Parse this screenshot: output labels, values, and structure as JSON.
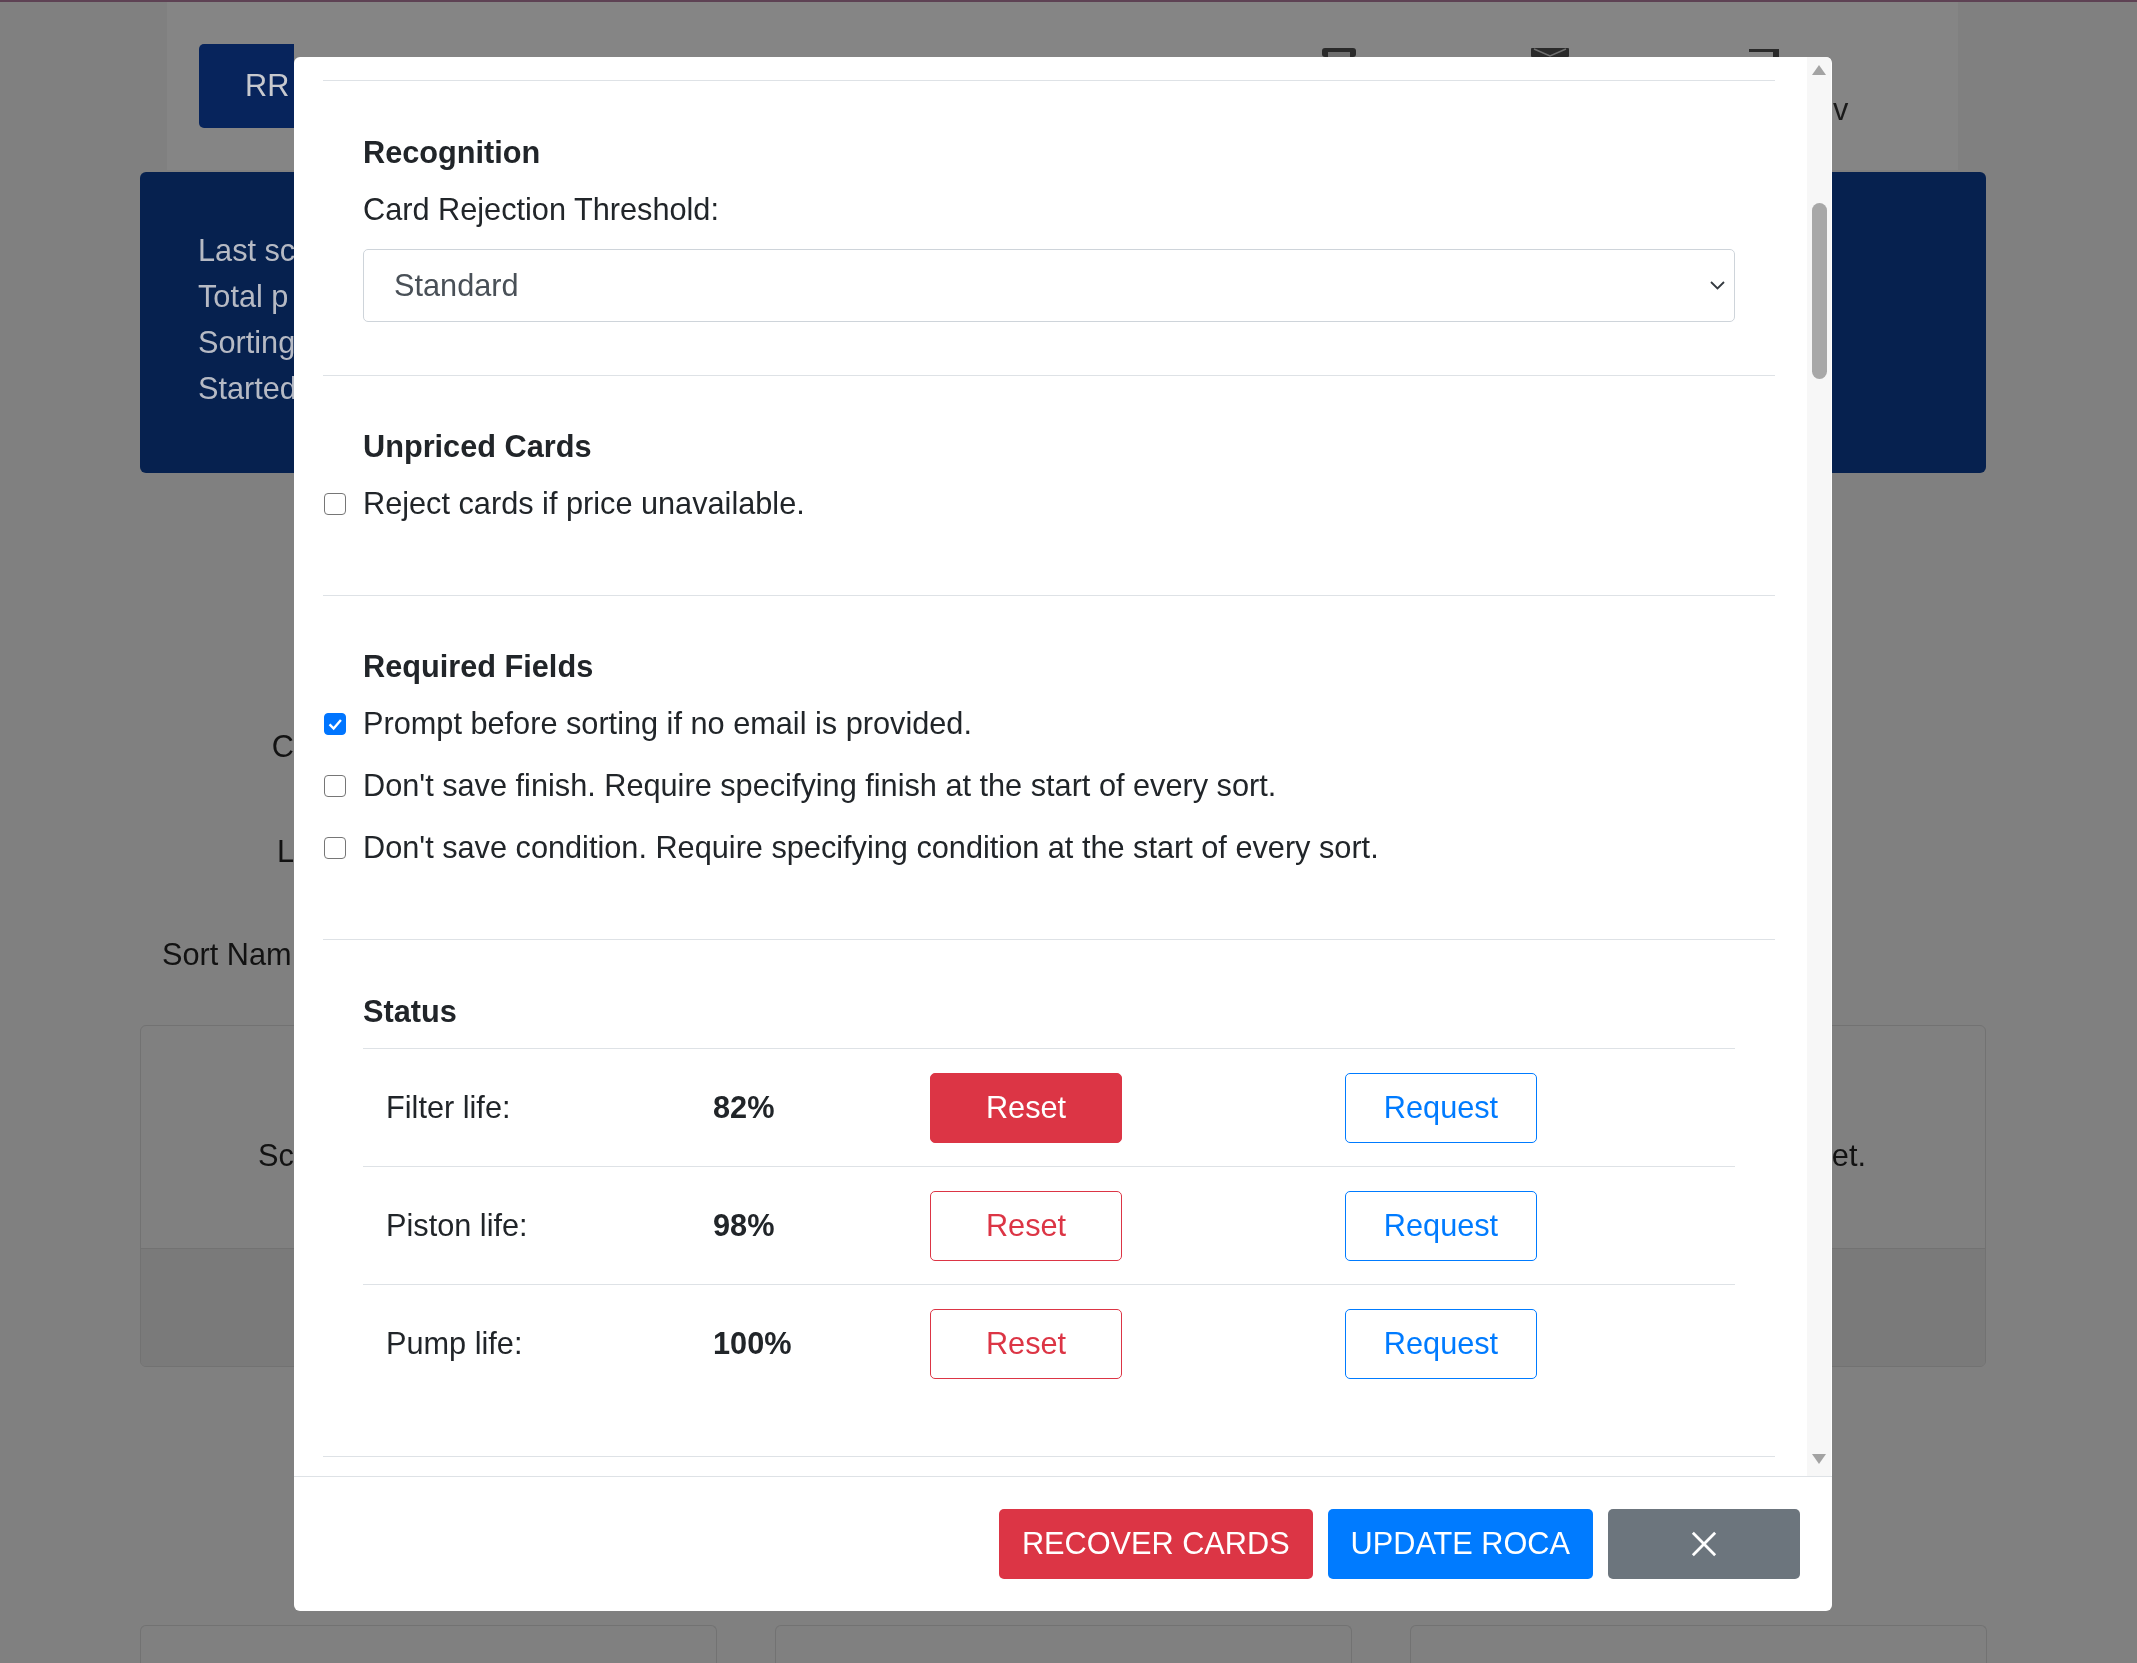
{
  "background_page": {
    "navbar": {
      "button": "RR",
      "label": "v"
    },
    "stats_panel": {
      "lines": [
        "Last sc",
        "Total p",
        "Sorting",
        "Started"
      ]
    },
    "texts": [
      "C",
      "L"
    ],
    "sort_name_label": "Sort Nam",
    "sort_card": {
      "texts": [
        "Sc",
        "et."
      ]
    }
  },
  "modal": {
    "sections": [
      {
        "kind": "select",
        "title": "Recognition",
        "label": "Card Rejection Threshold:",
        "value": "Standard"
      },
      {
        "kind": "checks",
        "title": "Unpriced Cards",
        "options": [
          {
            "label": "Reject cards if price unavailable.",
            "checked": false
          }
        ]
      },
      {
        "kind": "checks",
        "title": "Required Fields",
        "options": [
          {
            "label": "Prompt before sorting if no email is provided.",
            "checked": true
          },
          {
            "label": "Don't save finish. Require specifying finish at the start of every sort.",
            "checked": false
          },
          {
            "label": "Don't save condition. Require specifying condition at the start of every sort.",
            "checked": false
          }
        ]
      },
      {
        "kind": "status",
        "title": "Status",
        "rows": [
          {
            "label": "Filter life:",
            "value": "82%",
            "reset": "Reset",
            "reset_active": true,
            "request": "Request"
          },
          {
            "label": "Piston life:",
            "value": "98%",
            "reset": "Reset",
            "reset_active": false,
            "request": "Request"
          },
          {
            "label": "Pump life:",
            "value": "100%",
            "reset": "Reset",
            "reset_active": false,
            "request": "Request"
          }
        ]
      }
    ],
    "footer_buttons": [
      {
        "kind": "recover",
        "label": "RECOVER CARDS"
      },
      {
        "kind": "update",
        "label": "UPDATE ROCA"
      },
      {
        "kind": "close"
      }
    ]
  }
}
